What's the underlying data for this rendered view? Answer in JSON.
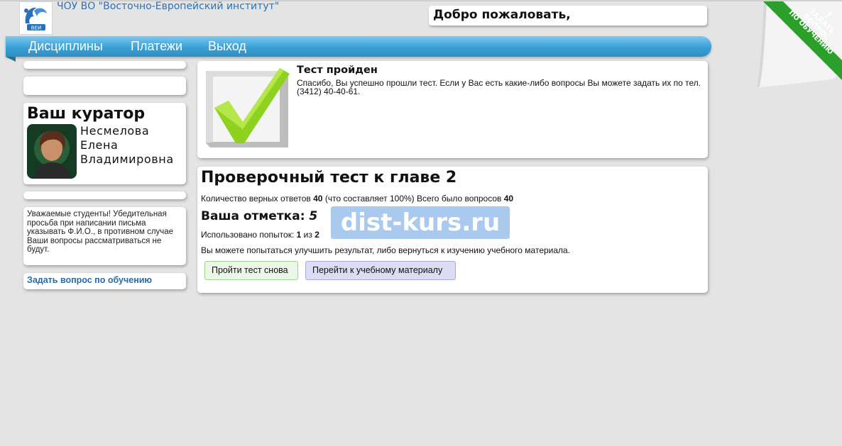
{
  "header": {
    "org_name": "ЧОУ ВО \"Восточно-Европейский институт\"",
    "logo_text": "ВЕИ",
    "welcome": "Добро пожаловать,"
  },
  "nav": {
    "items": [
      {
        "label": "Дисциплины"
      },
      {
        "label": "Платежи"
      },
      {
        "label": "Выход"
      }
    ]
  },
  "corner": {
    "question_mark": "?",
    "line1": "ЗАДАТЬ",
    "line2": "ВОПРОС",
    "line3": "ПО ОБУЧЕНИЮ"
  },
  "sidebar": {
    "curator_title": "Ваш куратор",
    "curator_name": "Несмелова Елена Владимировна",
    "notice": "Уважаемые студенты! Убедительная просьба при написании письма указывать Ф.И.О., в противном случае Ваши вопросы рассматриваться не будут.",
    "ask_link": "Задать вопрос по обучению"
  },
  "result": {
    "title": "Тест пройден",
    "text": "Спасибо, Вы успешно прошли тест. Если у Вас есть какие-либо вопросы Вы можете задать их по тел. (3412) 40-40-61."
  },
  "test": {
    "title": "Проверочный тест к главе 2",
    "correct_label": "Количество верных ответов",
    "correct_value": "40",
    "percent_text": "(что составляет 100%) Всего было вопросов",
    "total_value": "40",
    "grade_label": "Ваша отметка:",
    "grade_value": "5",
    "attempts_label": "Использовано попыток:",
    "attempts_used": "1",
    "attempts_of": "из",
    "attempts_total": "2",
    "hint": "Вы можете попытаться улучшить результат, либо вернуться к изучению учебного материала.",
    "retry_button": "Пройти тест снова",
    "material_button": "Перейти к учебному материалу"
  },
  "watermark": "dist-kurs.ru",
  "colors": {
    "nav": "#3aa1d6",
    "link": "#2a6aa8",
    "corner": "#2aa02a",
    "check": "#8fd11f"
  }
}
